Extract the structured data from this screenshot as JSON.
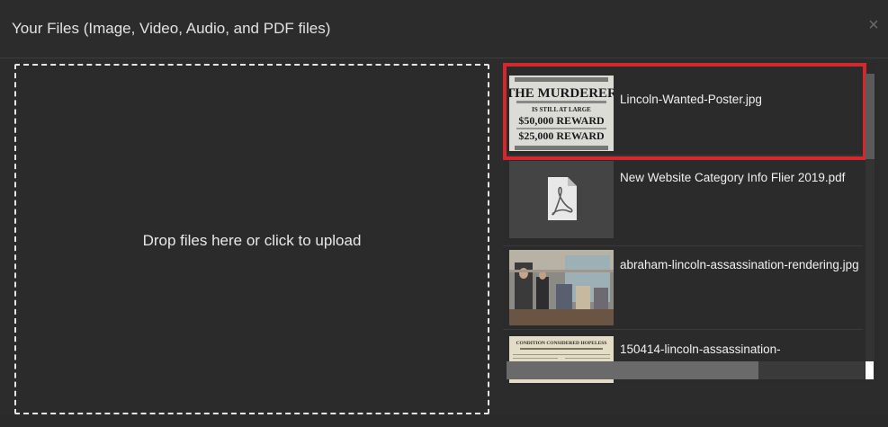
{
  "modal": {
    "title": "Your Files (Image, Video, Audio, and PDF files)",
    "close_label": "×"
  },
  "dropzone": {
    "text": "Drop files here or click to upload"
  },
  "files": [
    {
      "name": "Lincoln-Wanted-Poster.jpg",
      "type": "image",
      "selected": true
    },
    {
      "name": "New Website Category Info Flier 2019.pdf",
      "type": "pdf",
      "icon": "pdf-icon"
    },
    {
      "name": "abraham-lincoln-assassination-rendering.jpg",
      "type": "image"
    },
    {
      "name": "150414-lincoln-assassination-",
      "type": "image"
    }
  ],
  "poster": {
    "line1": "THE  MURDERER",
    "line2": "IS STILL AT LARGE",
    "line3": "$50,000  REWARD",
    "line4": "$25,000  REWARD"
  },
  "news": {
    "headline": "CONDITION CONSIDERED HOPELESS"
  },
  "colors": {
    "accent": "#d7262c",
    "background": "#2c2c2c",
    "text": "#f0f0f0"
  }
}
